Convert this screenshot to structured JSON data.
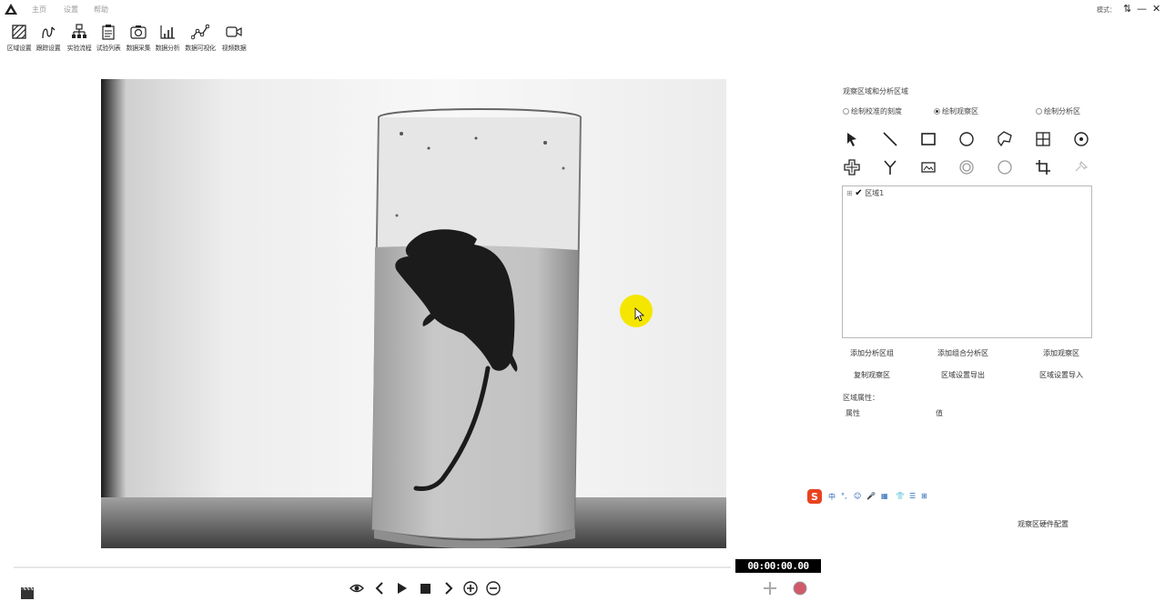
{
  "titlebar": {
    "menu": [
      "主页",
      "设置",
      "帮助"
    ],
    "style_label": "模式：",
    "controls": [
      "⇅",
      "—",
      "✕"
    ]
  },
  "toolbar": {
    "items": [
      {
        "label": "区域设置",
        "icon": "region-hatch-icon"
      },
      {
        "label": "跟踪设置",
        "icon": "tracking-icon"
      },
      {
        "label": "实验流程",
        "icon": "flowchart-icon"
      },
      {
        "label": "试验列表",
        "icon": "clipboard-list-icon"
      },
      {
        "label": "数据采集",
        "icon": "camera-icon"
      },
      {
        "label": "数据分析",
        "icon": "bar-chart-icon"
      },
      {
        "label": "数据可视化",
        "icon": "line-chart-icon"
      },
      {
        "label": "视频数据",
        "icon": "video-camera-icon"
      }
    ]
  },
  "panel": {
    "section_title": "观察区域和分析区域",
    "radio_options": [
      {
        "label": "绘制校准的刻度",
        "checked": false
      },
      {
        "label": "绘制观察区",
        "checked": true
      },
      {
        "label": "绘制分析区",
        "checked": false
      }
    ],
    "draw_tools_row1": [
      "pointer-arrow-icon",
      "line-icon",
      "rectangle-icon",
      "circle-icon",
      "polygon-icon",
      "grid-icon",
      "circle-dot-icon"
    ],
    "draw_tools_row2": [
      "cross-icon",
      "y-split-icon",
      "image-frame-icon",
      "ring-icon",
      "ellipse-icon",
      "crop-icon",
      "pin-icon"
    ],
    "region_tree": [
      {
        "expander": "⊞",
        "checkmark": "✔",
        "label": "区域1"
      }
    ],
    "buttons_row1": [
      "添加分析区组",
      "添加组合分析区",
      "添加观察区"
    ],
    "buttons_row2": [
      "复制观察区",
      "区域设置导出",
      "区域设置导入"
    ],
    "props_title": "区域属性：",
    "props_headers": [
      "属性",
      "值"
    ],
    "config_label": "观察区硬件配置"
  },
  "ime": {
    "items": [
      "中",
      "°,",
      "☺",
      "🎤",
      "▦",
      "👕",
      "☰",
      "⊞"
    ]
  },
  "player": {
    "timecode": "00:00:00.00",
    "controls": [
      "eye-icon",
      "prev-icon",
      "play-icon",
      "stop-icon",
      "next-icon",
      "zoom-in-icon",
      "zoom-out-icon"
    ],
    "progress": 0
  }
}
